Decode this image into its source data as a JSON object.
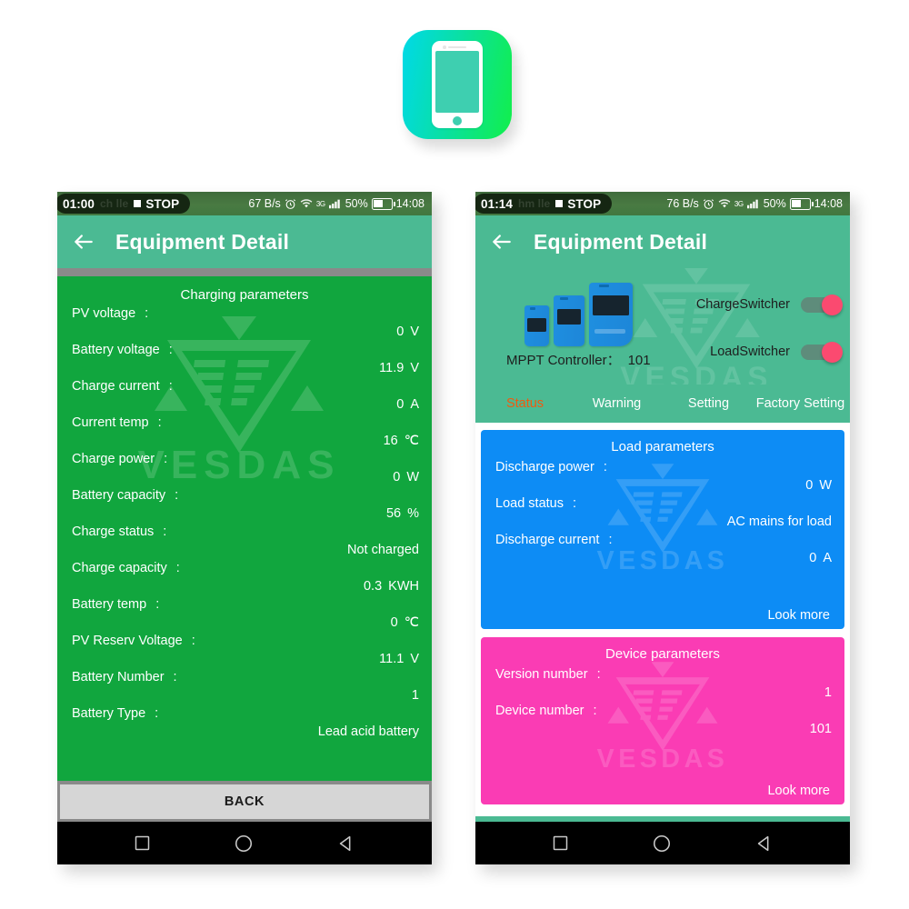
{
  "app_icon": {
    "name": "mobile-app-icon",
    "gradient_from": "#00d9e8",
    "gradient_to": "#12ef4a"
  },
  "colors": {
    "header_green": "#4bba93",
    "content_green": "#11a63e",
    "card_blue": "#0d8cf5",
    "card_pink": "#fa3cb4",
    "tab_active_orange": "#f05a10",
    "toggle_knob": "#fb4a70",
    "status_bar_green": "#447841",
    "back_button_gray": "#d6d6d6"
  },
  "left_phone": {
    "statusbar": {
      "stop_timer": "01:00",
      "stop_label": "STOP",
      "ghost_text": "ch   lle",
      "net_speed": "67 B/s",
      "battery_percent": "50%",
      "clock": "14:08",
      "icons": [
        "alarm-clock-icon",
        "wifi-icon",
        "signal-3g-icon",
        "battery-icon"
      ]
    },
    "appbar": {
      "back_icon": "back-arrow-icon",
      "title": "Equipment Detail"
    },
    "panel": {
      "title": "Charging parameters",
      "watermark": "VESDAS",
      "rows": [
        {
          "label": "PV voltage",
          "colon": ":",
          "value": "0",
          "unit": "V"
        },
        {
          "label": "Battery voltage",
          "colon": ":",
          "value": "11.9",
          "unit": "V"
        },
        {
          "label": "Charge current",
          "colon": ":",
          "value": "0",
          "unit": "A"
        },
        {
          "label": "Current temp",
          "colon": ":",
          "value": "16",
          "unit": "℃"
        },
        {
          "label": "Charge power",
          "colon": ":",
          "value": "0",
          "unit": "W"
        },
        {
          "label": "Battery capacity",
          "colon": ":",
          "value": "56",
          "unit": "%"
        },
        {
          "label": "Charge status",
          "colon": ":",
          "value": "Not charged",
          "unit": ""
        },
        {
          "label": "Charge capacity",
          "colon": ":",
          "value": "0.3",
          "unit": "KWH"
        },
        {
          "label": "Battery temp",
          "colon": ":",
          "value": "0",
          "unit": "℃"
        },
        {
          "label": "PV Reserv Voltage",
          "colon": ":",
          "value": "11.1",
          "unit": "V"
        },
        {
          "label": "Battery Number",
          "colon": ":",
          "value": "1",
          "unit": ""
        },
        {
          "label": "Battery Type",
          "colon": ":",
          "value": "Lead acid battery",
          "unit": ""
        }
      ]
    },
    "back_button": "BACK",
    "navbar": [
      "recents-square-icon",
      "home-circle-icon",
      "back-triangle-icon"
    ]
  },
  "right_phone": {
    "statusbar": {
      "stop_timer": "01:14",
      "stop_label": "STOP",
      "ghost_text": "hm  lle",
      "net_speed": "76 B/s",
      "battery_percent": "50%",
      "clock": "14:08",
      "icons": [
        "alarm-clock-icon",
        "wifi-icon",
        "signal-3g-icon",
        "battery-icon"
      ]
    },
    "appbar": {
      "back_icon": "back-arrow-icon",
      "title": "Equipment Detail"
    },
    "device_panel": {
      "controller_label": "MPPT Controller：",
      "controller_id": "101",
      "watermark": "VESDAS",
      "switchers": [
        {
          "label": "ChargeSwitcher",
          "state": "on"
        },
        {
          "label": "LoadSwitcher",
          "state": "on"
        }
      ]
    },
    "tabs": [
      {
        "label": "Status",
        "active": true
      },
      {
        "label": "Warning",
        "active": false
      },
      {
        "label": "Setting",
        "active": false
      },
      {
        "label": "Factory Setting",
        "active": false
      }
    ],
    "cards": [
      {
        "title": "Load parameters",
        "color": "#0d8cf5",
        "look_more": "Look more",
        "rows": [
          {
            "label": "Discharge power",
            "colon": ":",
            "value": "0",
            "unit": "W"
          },
          {
            "label": "Load status",
            "colon": ":",
            "value": "AC mains for load",
            "unit": ""
          },
          {
            "label": "Discharge current",
            "colon": ":",
            "value": "0",
            "unit": "A"
          }
        ]
      },
      {
        "title": "Device parameters",
        "color": "#fa3cb4",
        "look_more": "Look more",
        "rows": [
          {
            "label": "Version number",
            "colon": ":",
            "value": "1",
            "unit": ""
          },
          {
            "label": "Device number",
            "colon": ":",
            "value": "101",
            "unit": ""
          }
        ]
      }
    ],
    "navbar": [
      "recents-square-icon",
      "home-circle-icon",
      "back-triangle-icon"
    ]
  }
}
